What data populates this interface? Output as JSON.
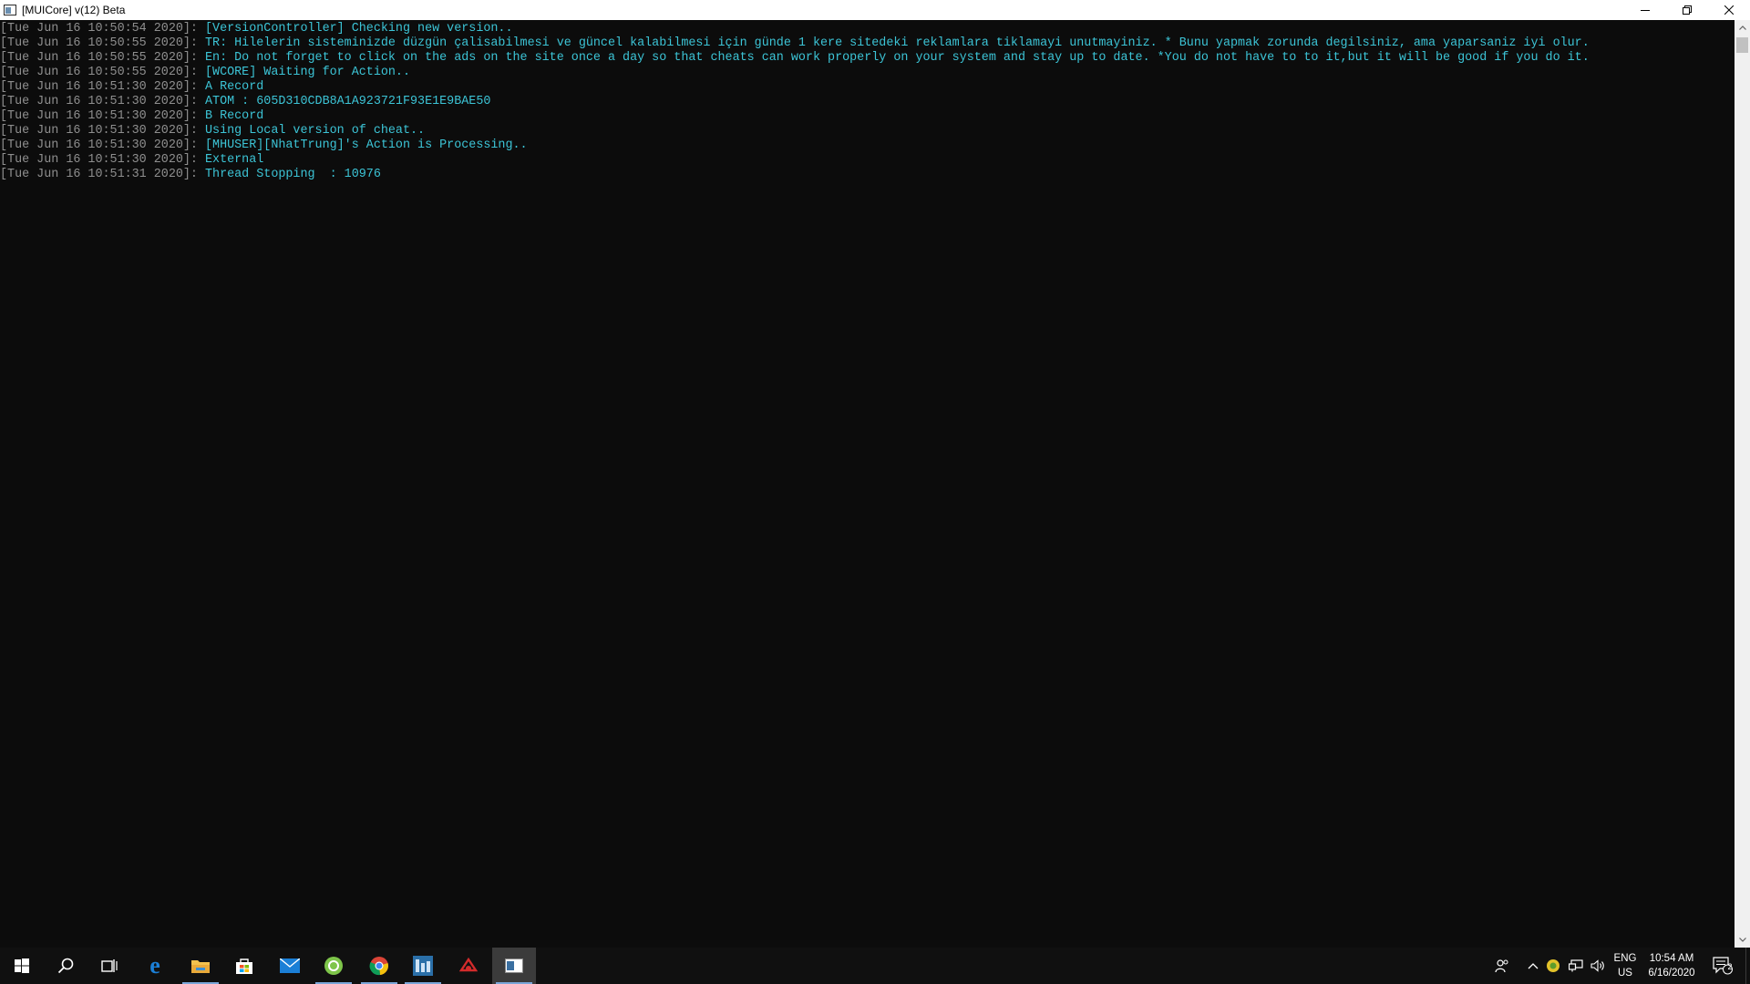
{
  "window": {
    "title": "[MUICore] v(12) Beta"
  },
  "console": {
    "lines": [
      {
        "ts": "[Tue Jun 16 10:50:54 2020]:",
        "msg": " [VersionController] Checking new version.."
      },
      {
        "ts": "[Tue Jun 16 10:50:55 2020]:",
        "msg": " TR: Hilelerin sisteminizde düzgün çalisabilmesi ve güncel kalabilmesi için günde 1 kere sitedeki reklamlara tiklamayi unutmayiniz. * Bunu yapmak zorunda degilsiniz, ama yaparsaniz iyi olur."
      },
      {
        "ts": "[Tue Jun 16 10:50:55 2020]:",
        "msg": " En: Do not forget to click on the ads on the site once a day so that cheats can work properly on your system and stay up to date. *You do not have to to it,but it will be good if you do it."
      },
      {
        "ts": "[Tue Jun 16 10:50:55 2020]:",
        "msg": " [WCORE] Waiting for Action.."
      },
      {
        "ts": "[Tue Jun 16 10:51:30 2020]:",
        "msg": " A Record"
      },
      {
        "ts": "[Tue Jun 16 10:51:30 2020]:",
        "msg": " ATOM : 605D310CDB8A1A923721F93E1E9BAE50"
      },
      {
        "ts": "[Tue Jun 16 10:51:30 2020]:",
        "msg": " B Record"
      },
      {
        "ts": "[Tue Jun 16 10:51:30 2020]:",
        "msg": " Using Local version of cheat.."
      },
      {
        "ts": "[Tue Jun 16 10:51:30 2020]:",
        "msg": " [MHUSER][NhatTrung]'s Action is Processing.."
      },
      {
        "ts": "[Tue Jun 16 10:51:30 2020]:",
        "msg": " External"
      },
      {
        "ts": "[Tue Jun 16 10:51:31 2020]:",
        "msg": " Thread Stopping  : 10976"
      }
    ]
  },
  "colors": {
    "console_bg": "#0c0c0c",
    "timestamp": "#8f8f8f",
    "message": "#3cc4d6",
    "taskbar_bg": "#101010"
  },
  "taskbar": {
    "apps": [
      {
        "name": "start-icon"
      },
      {
        "name": "search-icon"
      },
      {
        "name": "task-view-icon"
      },
      {
        "name": "edge-icon"
      },
      {
        "name": "file-explorer-icon",
        "open": true
      },
      {
        "name": "store-icon"
      },
      {
        "name": "mail-icon"
      },
      {
        "name": "green-app-icon",
        "open": true
      },
      {
        "name": "chrome-icon",
        "open": true
      },
      {
        "name": "tile-app-icon",
        "open": true
      },
      {
        "name": "red-app-icon"
      },
      {
        "name": "console-app-icon",
        "open": true,
        "active": true
      }
    ],
    "tray": {
      "language_line1": "ENG",
      "language_line2": "US",
      "time": "10:54 AM",
      "date": "6/16/2020",
      "notification_count": "2"
    }
  }
}
